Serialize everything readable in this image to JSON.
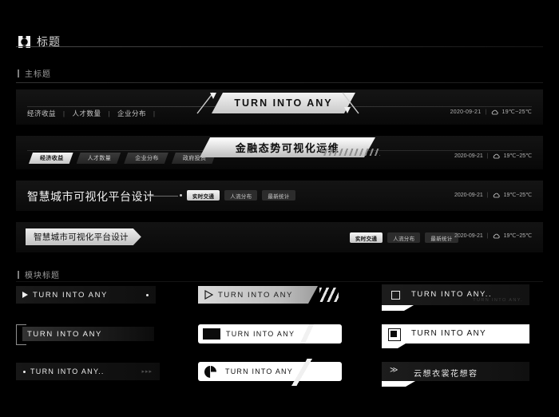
{
  "topbar": {
    "logo_icon": "hexagon-dot-icon",
    "title": "标题"
  },
  "sections": {
    "main_title_label": "主标题",
    "module_title_label": "模块标题"
  },
  "meta": {
    "date": "2020-09-21",
    "separator": "|",
    "weather_icon": "cloud-icon",
    "temperature": "19℃~25℃"
  },
  "banner1": {
    "menu": [
      "经济收益",
      "人才数量",
      "企业分布"
    ],
    "menu_separator": "|",
    "plate_title": "TURN INTO ANY"
  },
  "banner2": {
    "tabs": [
      {
        "label": "经济收益",
        "active": true
      },
      {
        "label": "人才数量",
        "active": false
      },
      {
        "label": "企业分布",
        "active": false
      },
      {
        "label": "政府投资",
        "active": false
      }
    ],
    "plate_title": "金融态势可视化运维"
  },
  "banner3": {
    "title": "智慧城市可视化平台设计",
    "arrow": "〉",
    "pills": [
      {
        "label": "实时交通",
        "active": true
      },
      {
        "label": "人流分布",
        "active": false
      },
      {
        "label": "最新统计",
        "active": false
      }
    ]
  },
  "banner4": {
    "plate_title": "智慧城市可视化平台设计",
    "pills": [
      {
        "label": "实时交通",
        "active": true
      },
      {
        "label": "人流分布",
        "active": false
      },
      {
        "label": "最新统计",
        "active": false
      }
    ]
  },
  "modules": [
    {
      "id": "c1",
      "icon": "play-filled-icon",
      "label": "TURN INTO ANY",
      "accent": "dot-indicator"
    },
    {
      "id": "c2",
      "icon": "play-outline-icon",
      "label": "TURN INTO ANY",
      "accent": "triple-slash"
    },
    {
      "id": "c3",
      "icon": "square-outline-icon",
      "label": "TURN INTO ANY..",
      "subtitle": "TURN INTO ANY."
    },
    {
      "id": "c4",
      "icon": "bracket-corner-icon",
      "label": "TURN INTO ANY"
    },
    {
      "id": "c5",
      "icon": "block-filled-icon",
      "label": "TURN INTO ANY"
    },
    {
      "id": "c6",
      "icon": "square-filled-icon",
      "label": "TURN INTO ANY"
    },
    {
      "id": "c7",
      "icon": "bullet-dot-icon",
      "label": "TURN INTO ANY..",
      "accent": "▸▸▸"
    },
    {
      "id": "c8",
      "icon": "pie-half-icon",
      "label": "TURN INTO ANY"
    },
    {
      "id": "c9",
      "icon": "double-chevron-icon",
      "label": "云想衣裳花想容"
    }
  ],
  "colors": {
    "background": "#000000",
    "panel": "#0d0d0d",
    "accent_light": "#ffffff",
    "text_primary": "#ececec",
    "text_muted": "#9a9a9a"
  }
}
